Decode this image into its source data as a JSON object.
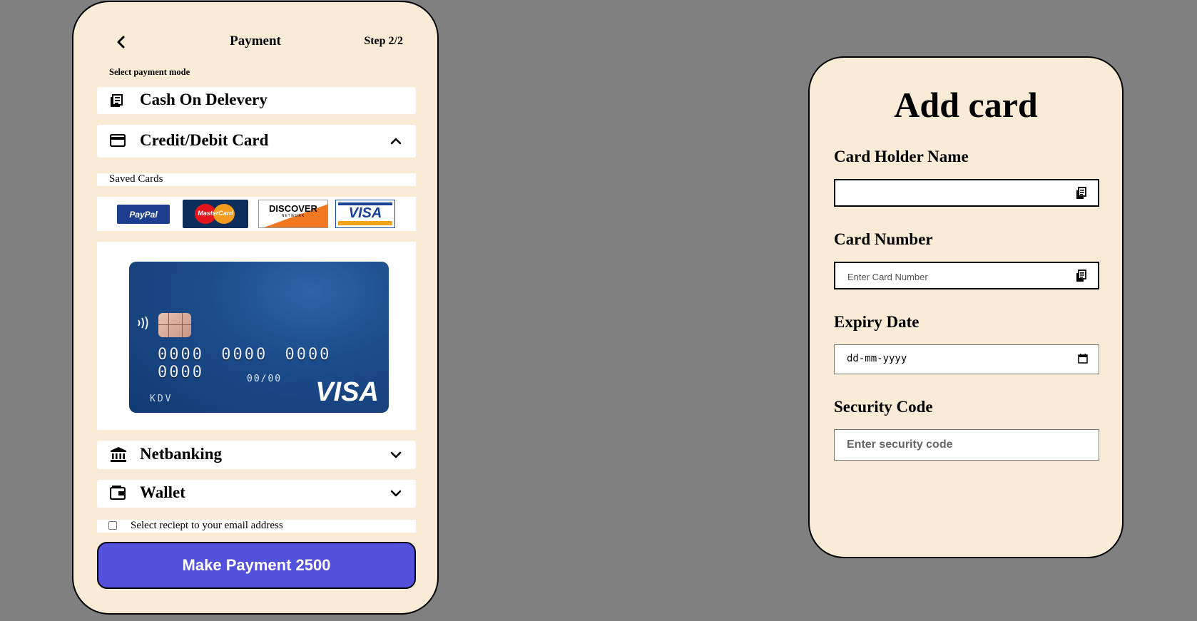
{
  "payment": {
    "title": "Payment",
    "step": "Step 2/2",
    "select_mode_label": "Select payment mode",
    "options": {
      "cod": "Cash On Delevery",
      "card": "Credit/Debit Card",
      "netbanking": "Netbanking",
      "wallet": "Wallet"
    },
    "saved_cards_label": "Saved Cards",
    "logos": [
      "PayPal",
      "MasterCard",
      "DISCOVER",
      "VISA"
    ],
    "discover_sub": "NETWORK",
    "card": {
      "number": "0000 0000 0000 0000",
      "expiry": "00/00",
      "holder": "KDV",
      "brand": "VISA"
    },
    "email_receipt_label": "Select reciept to your email address",
    "pay_button": "Make Payment 2500"
  },
  "add_card": {
    "title": "Add card",
    "holder_label": "Card Holder Name",
    "holder_value": "",
    "number_label": "Card Number",
    "number_placeholder": "Enter Card Number",
    "expiry_label": "Expiry Date",
    "expiry_placeholder": "dd-mm-yyyy",
    "security_label": "Security Code",
    "security_placeholder": "Enter security code"
  },
  "icons": [
    "back-icon",
    "cash-icon",
    "card-icon",
    "bank-icon",
    "wallet-icon",
    "chevron-up-icon",
    "chevron-down-icon",
    "calendar-icon",
    "autofill-icon"
  ],
  "colors": {
    "background": "#808080",
    "panel": "#faebd7",
    "pay_button": "#5350dc"
  }
}
